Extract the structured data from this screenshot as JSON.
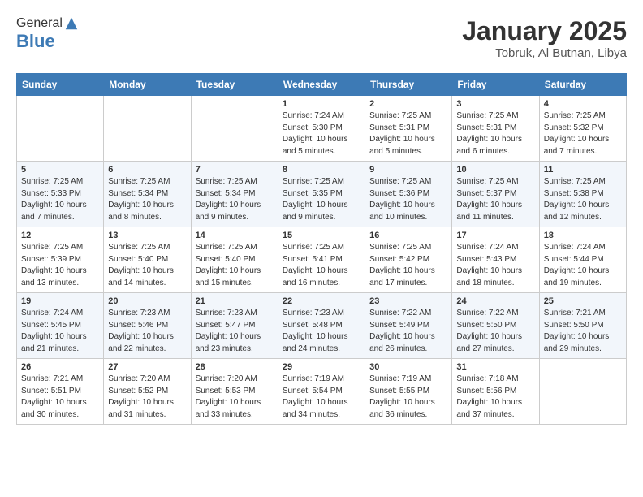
{
  "header": {
    "logo_line1": "General",
    "logo_line2": "Blue",
    "title": "January 2025",
    "subtitle": "Tobruk, Al Butnan, Libya"
  },
  "weekdays": [
    "Sunday",
    "Monday",
    "Tuesday",
    "Wednesday",
    "Thursday",
    "Friday",
    "Saturday"
  ],
  "weeks": [
    [
      {
        "day": "",
        "sunrise": "",
        "sunset": "",
        "daylight": ""
      },
      {
        "day": "",
        "sunrise": "",
        "sunset": "",
        "daylight": ""
      },
      {
        "day": "",
        "sunrise": "",
        "sunset": "",
        "daylight": ""
      },
      {
        "day": "1",
        "sunrise": "Sunrise: 7:24 AM",
        "sunset": "Sunset: 5:30 PM",
        "daylight": "Daylight: 10 hours and 5 minutes."
      },
      {
        "day": "2",
        "sunrise": "Sunrise: 7:25 AM",
        "sunset": "Sunset: 5:31 PM",
        "daylight": "Daylight: 10 hours and 5 minutes."
      },
      {
        "day": "3",
        "sunrise": "Sunrise: 7:25 AM",
        "sunset": "Sunset: 5:31 PM",
        "daylight": "Daylight: 10 hours and 6 minutes."
      },
      {
        "day": "4",
        "sunrise": "Sunrise: 7:25 AM",
        "sunset": "Sunset: 5:32 PM",
        "daylight": "Daylight: 10 hours and 7 minutes."
      }
    ],
    [
      {
        "day": "5",
        "sunrise": "Sunrise: 7:25 AM",
        "sunset": "Sunset: 5:33 PM",
        "daylight": "Daylight: 10 hours and 7 minutes."
      },
      {
        "day": "6",
        "sunrise": "Sunrise: 7:25 AM",
        "sunset": "Sunset: 5:34 PM",
        "daylight": "Daylight: 10 hours and 8 minutes."
      },
      {
        "day": "7",
        "sunrise": "Sunrise: 7:25 AM",
        "sunset": "Sunset: 5:34 PM",
        "daylight": "Daylight: 10 hours and 9 minutes."
      },
      {
        "day": "8",
        "sunrise": "Sunrise: 7:25 AM",
        "sunset": "Sunset: 5:35 PM",
        "daylight": "Daylight: 10 hours and 9 minutes."
      },
      {
        "day": "9",
        "sunrise": "Sunrise: 7:25 AM",
        "sunset": "Sunset: 5:36 PM",
        "daylight": "Daylight: 10 hours and 10 minutes."
      },
      {
        "day": "10",
        "sunrise": "Sunrise: 7:25 AM",
        "sunset": "Sunset: 5:37 PM",
        "daylight": "Daylight: 10 hours and 11 minutes."
      },
      {
        "day": "11",
        "sunrise": "Sunrise: 7:25 AM",
        "sunset": "Sunset: 5:38 PM",
        "daylight": "Daylight: 10 hours and 12 minutes."
      }
    ],
    [
      {
        "day": "12",
        "sunrise": "Sunrise: 7:25 AM",
        "sunset": "Sunset: 5:39 PM",
        "daylight": "Daylight: 10 hours and 13 minutes."
      },
      {
        "day": "13",
        "sunrise": "Sunrise: 7:25 AM",
        "sunset": "Sunset: 5:40 PM",
        "daylight": "Daylight: 10 hours and 14 minutes."
      },
      {
        "day": "14",
        "sunrise": "Sunrise: 7:25 AM",
        "sunset": "Sunset: 5:40 PM",
        "daylight": "Daylight: 10 hours and 15 minutes."
      },
      {
        "day": "15",
        "sunrise": "Sunrise: 7:25 AM",
        "sunset": "Sunset: 5:41 PM",
        "daylight": "Daylight: 10 hours and 16 minutes."
      },
      {
        "day": "16",
        "sunrise": "Sunrise: 7:25 AM",
        "sunset": "Sunset: 5:42 PM",
        "daylight": "Daylight: 10 hours and 17 minutes."
      },
      {
        "day": "17",
        "sunrise": "Sunrise: 7:24 AM",
        "sunset": "Sunset: 5:43 PM",
        "daylight": "Daylight: 10 hours and 18 minutes."
      },
      {
        "day": "18",
        "sunrise": "Sunrise: 7:24 AM",
        "sunset": "Sunset: 5:44 PM",
        "daylight": "Daylight: 10 hours and 19 minutes."
      }
    ],
    [
      {
        "day": "19",
        "sunrise": "Sunrise: 7:24 AM",
        "sunset": "Sunset: 5:45 PM",
        "daylight": "Daylight: 10 hours and 21 minutes."
      },
      {
        "day": "20",
        "sunrise": "Sunrise: 7:23 AM",
        "sunset": "Sunset: 5:46 PM",
        "daylight": "Daylight: 10 hours and 22 minutes."
      },
      {
        "day": "21",
        "sunrise": "Sunrise: 7:23 AM",
        "sunset": "Sunset: 5:47 PM",
        "daylight": "Daylight: 10 hours and 23 minutes."
      },
      {
        "day": "22",
        "sunrise": "Sunrise: 7:23 AM",
        "sunset": "Sunset: 5:48 PM",
        "daylight": "Daylight: 10 hours and 24 minutes."
      },
      {
        "day": "23",
        "sunrise": "Sunrise: 7:22 AM",
        "sunset": "Sunset: 5:49 PM",
        "daylight": "Daylight: 10 hours and 26 minutes."
      },
      {
        "day": "24",
        "sunrise": "Sunrise: 7:22 AM",
        "sunset": "Sunset: 5:50 PM",
        "daylight": "Daylight: 10 hours and 27 minutes."
      },
      {
        "day": "25",
        "sunrise": "Sunrise: 7:21 AM",
        "sunset": "Sunset: 5:50 PM",
        "daylight": "Daylight: 10 hours and 29 minutes."
      }
    ],
    [
      {
        "day": "26",
        "sunrise": "Sunrise: 7:21 AM",
        "sunset": "Sunset: 5:51 PM",
        "daylight": "Daylight: 10 hours and 30 minutes."
      },
      {
        "day": "27",
        "sunrise": "Sunrise: 7:20 AM",
        "sunset": "Sunset: 5:52 PM",
        "daylight": "Daylight: 10 hours and 31 minutes."
      },
      {
        "day": "28",
        "sunrise": "Sunrise: 7:20 AM",
        "sunset": "Sunset: 5:53 PM",
        "daylight": "Daylight: 10 hours and 33 minutes."
      },
      {
        "day": "29",
        "sunrise": "Sunrise: 7:19 AM",
        "sunset": "Sunset: 5:54 PM",
        "daylight": "Daylight: 10 hours and 34 minutes."
      },
      {
        "day": "30",
        "sunrise": "Sunrise: 7:19 AM",
        "sunset": "Sunset: 5:55 PM",
        "daylight": "Daylight: 10 hours and 36 minutes."
      },
      {
        "day": "31",
        "sunrise": "Sunrise: 7:18 AM",
        "sunset": "Sunset: 5:56 PM",
        "daylight": "Daylight: 10 hours and 37 minutes."
      },
      {
        "day": "",
        "sunrise": "",
        "sunset": "",
        "daylight": ""
      }
    ]
  ]
}
